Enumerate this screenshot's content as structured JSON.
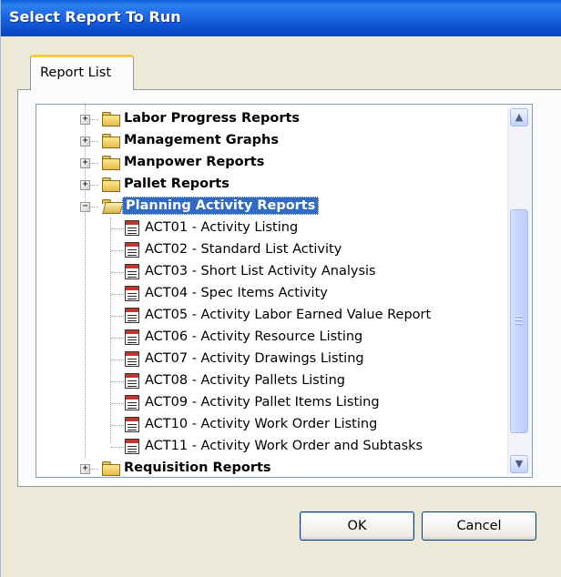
{
  "window": {
    "title": "Select Report To Run"
  },
  "tabs": [
    {
      "label": "Report List"
    }
  ],
  "tree": {
    "folders_top": [
      {
        "label": "Labor Progress Reports",
        "toggle": "+"
      },
      {
        "label": "Management Graphs",
        "toggle": "+"
      },
      {
        "label": "Manpower Reports",
        "toggle": "+"
      },
      {
        "label": "Pallet Reports",
        "toggle": "+"
      }
    ],
    "expanded_folder": {
      "label": "Planning Activity Reports",
      "toggle": "−",
      "selected": true
    },
    "reports": [
      "ACT01 - Activity Listing",
      "ACT02 - Standard List Activity",
      "ACT03 - Short List  Activity Analysis",
      "ACT04 - Spec Items  Activity",
      "ACT05 - Activity Labor Earned Value Report",
      "ACT06 - Activity Resource Listing",
      "ACT07 - Activity Drawings Listing",
      "ACT08 - Activity Pallets Listing",
      "ACT09 - Activity Pallet Items  Listing",
      "ACT10 - Activity Work Order Listing",
      "ACT11 - Activity Work Order and Subtasks"
    ],
    "folders_bottom": [
      {
        "label": "Requisition Reports",
        "toggle": "+"
      }
    ]
  },
  "scrollbar": {
    "up_glyph": "▲",
    "down_glyph": "▼"
  },
  "buttons": {
    "ok": "OK",
    "cancel": "Cancel"
  },
  "colors": {
    "title_bar": "#0b4fd0",
    "selection": "#316ac5",
    "window_bg": "#ece9d8",
    "tab_highlight": "#ffc73c"
  }
}
